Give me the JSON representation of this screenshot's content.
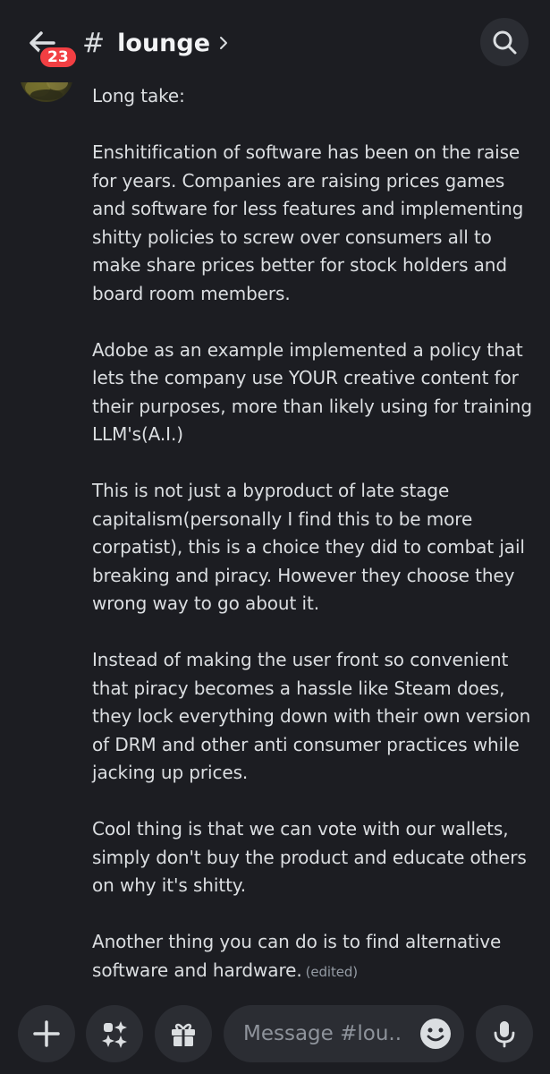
{
  "header": {
    "back_label": "Back",
    "unread_count": "23",
    "hash": "#",
    "channel_name": "lounge",
    "search_icon": "search-icon"
  },
  "message": {
    "paragraphs": [
      "Long take:",
      "Enshitification of software has been on the raise for years. Companies are raising prices games and software for less features and implementing shitty policies to screw over consumers all to make share prices better for stock holders and board room members.",
      "Adobe as an example implemented a policy that lets the company use YOUR creative content for their purposes, more than likely using for training LLM's(A.I.)",
      "This is not just a byproduct of late stage capitalism(personally I find this to be more corpatist), this is a choice they did to combat jail breaking and piracy. However they choose they wrong way to go about it.",
      "Instead of making the user front so convenient that piracy becomes a hassle like Steam does, they lock everything down with their own version of DRM and other anti consumer practices while jacking up prices.",
      "Cool thing is that we can vote with our wallets, simply don't buy the product and educate others on why it's shitty.",
      "Another thing you can do is to find alternative software and hardware."
    ],
    "edited_label": "(edited)"
  },
  "composer": {
    "placeholder": "Message #lou...",
    "icons": [
      "plus-icon",
      "apps-icon",
      "gift-icon",
      "emoji-icon",
      "microphone-icon"
    ]
  },
  "colors": {
    "background": "#1c1d22",
    "button_bg": "#2b2d33",
    "badge": "#f23f43",
    "text": "#dbdee1",
    "muted": "#949ba4"
  }
}
